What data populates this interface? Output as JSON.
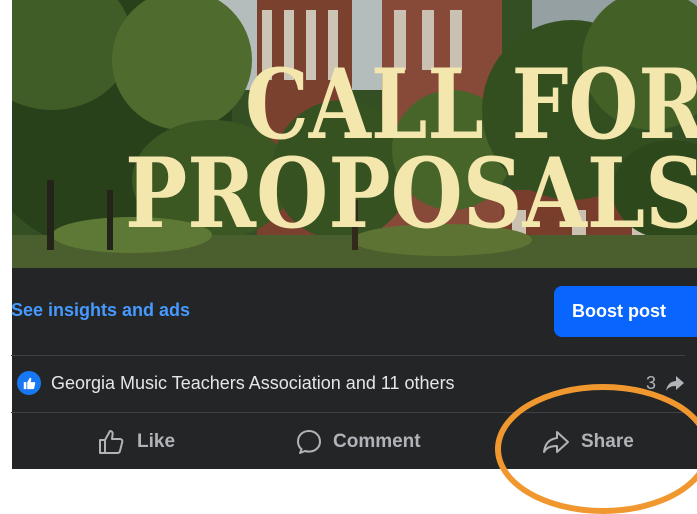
{
  "poster": {
    "line1": "CALL FOR",
    "line2": "PROPOSALS"
  },
  "insights": {
    "link_label": "See insights and ads",
    "boost_label": "Boost post"
  },
  "reactions": {
    "icon": "thumbs-up-icon",
    "summary": "Georgia Music Teachers Association and 11 others",
    "share_count": "3",
    "share_icon": "share-arrow-icon"
  },
  "actions": {
    "like": "Like",
    "comment": "Comment",
    "share": "Share"
  },
  "colors": {
    "background": "#242526",
    "link": "#4599ff",
    "boost": "#0866ff",
    "highlight": "#f0982f",
    "poster_text": "#f4e7ad"
  }
}
